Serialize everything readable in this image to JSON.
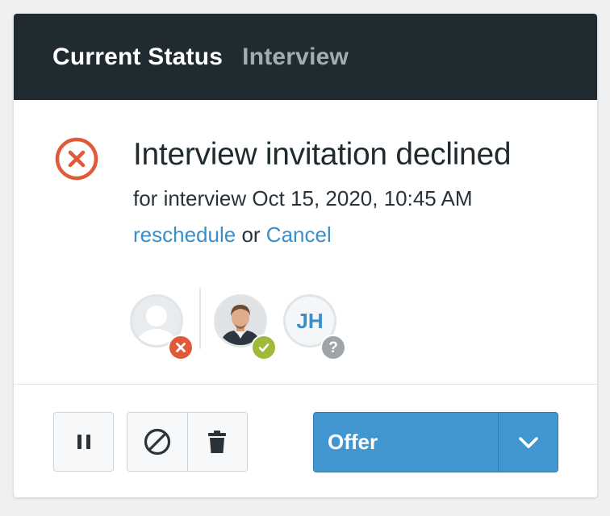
{
  "header": {
    "title": "Current Status",
    "subtitle": "Interview"
  },
  "status": {
    "icon": "error-circle-icon",
    "title": "Interview invitation declined",
    "subtitle": "for interview Oct 15, 2020, 10:45 AM",
    "reschedule_label": "reschedule",
    "or_text": "or",
    "cancel_label": "Cancel"
  },
  "participants": [
    {
      "type": "placeholder",
      "status": "declined",
      "badge_icon": "x-icon"
    },
    {
      "type": "photo",
      "status": "accepted",
      "badge_icon": "check-icon"
    },
    {
      "type": "initials",
      "initials": "JH",
      "status": "unknown",
      "badge_icon": "question-icon",
      "badge_text": "?"
    }
  ],
  "actions": {
    "pause_icon": "pause-icon",
    "block_icon": "block-icon",
    "delete_icon": "trash-icon",
    "primary_label": "Offer",
    "dropdown_icon": "chevron-down-icon"
  },
  "colors": {
    "header_bg": "#1f2b31",
    "accent": "#4296cf",
    "link": "#3a8fc9",
    "declined": "#e05a3a",
    "accepted": "#9fba3a",
    "unknown": "#9ea4a8"
  }
}
